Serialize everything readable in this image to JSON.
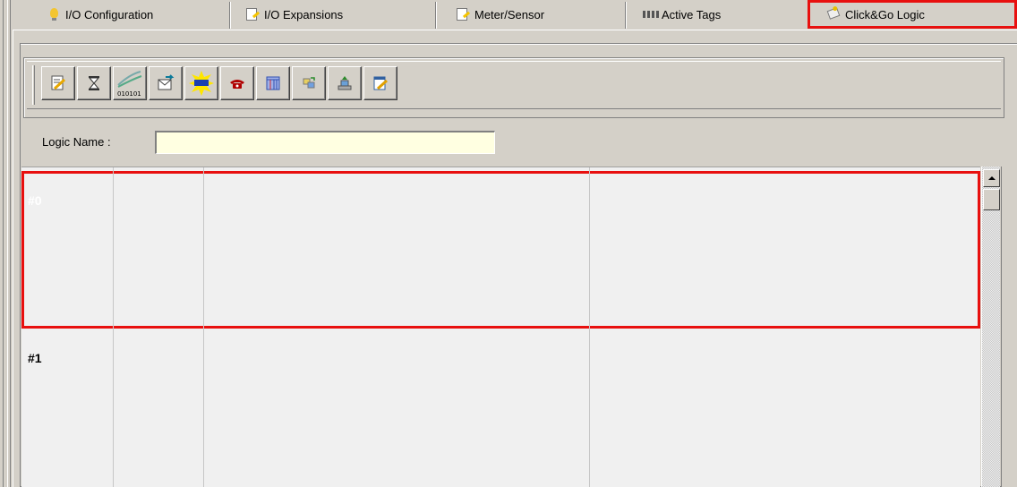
{
  "tabs": [
    {
      "label": "I/O Configuration",
      "icon": "lightbulb-icon"
    },
    {
      "label": "I/O Expansions",
      "icon": "edit-document-icon"
    },
    {
      "label": "Meter/Sensor",
      "icon": "edit-document-icon"
    },
    {
      "label": "Active Tags",
      "icon": "tags-icon"
    },
    {
      "label": "Click&Go Logic",
      "icon": "logic-icon",
      "active": true
    }
  ],
  "toolbar": {
    "buttons": [
      {
        "name": "edit-logic-icon"
      },
      {
        "name": "timer-hourglass-icon"
      },
      {
        "name": "binary-signal-icon",
        "text": "010101"
      },
      {
        "name": "send-message-icon"
      },
      {
        "name": "highlight-event-icon"
      },
      {
        "name": "telephone-icon"
      },
      {
        "name": "table-icon"
      },
      {
        "name": "transfer-icon"
      },
      {
        "name": "upload-icon"
      },
      {
        "name": "edit-form-icon"
      }
    ]
  },
  "logic_name": {
    "label": "Logic Name :",
    "value": ""
  },
  "rules": [
    {
      "label": "#0",
      "selected": true
    },
    {
      "label": "#1",
      "selected": false
    }
  ],
  "colors": {
    "accent_red": "#e8100f",
    "input_bg": "#ffffe1",
    "window_bg": "#d4d0c8"
  }
}
